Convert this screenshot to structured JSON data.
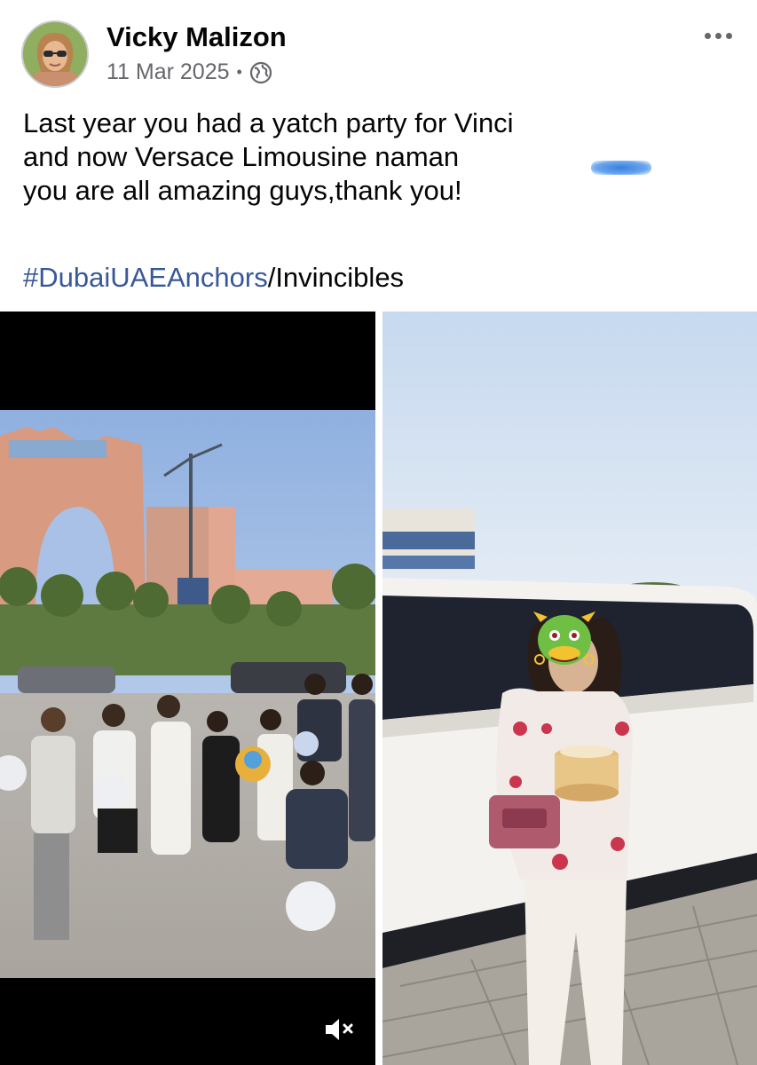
{
  "post": {
    "author": "Vicky Malizon",
    "date": "11 Mar 2025",
    "separator": "•",
    "privacy_icon": "globe-icon",
    "more_icon": "more-dots-icon",
    "lines": [
      "Last year you had a yatch party for Vinci",
      "and now Versace Limousine naman",
      "you are all amazing guys,thank you!"
    ],
    "hashtag": "#DubaiUAEAnchors",
    "hashtag_suffix": "/Invincibles"
  },
  "media": {
    "left_icon": "mute-icon",
    "right_emoji": "dragon-face-emoji"
  },
  "colors": {
    "hashtag": "#385898",
    "secondary_text": "#65676b",
    "primary_text": "#050505"
  }
}
